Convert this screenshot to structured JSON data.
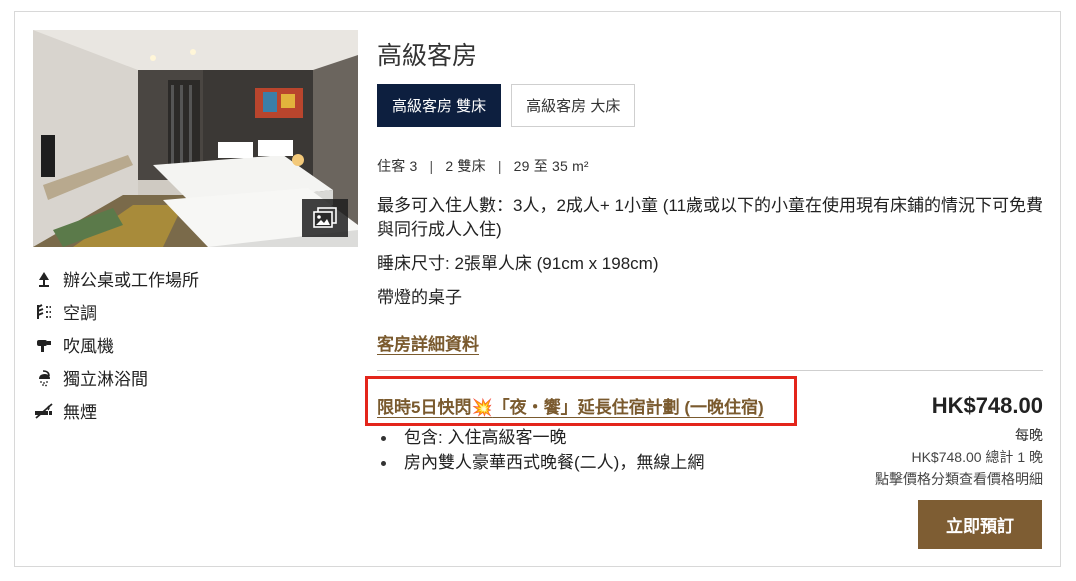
{
  "room": {
    "title": "高級客房",
    "tabs": [
      {
        "label": "高級客房 雙床",
        "active": true
      },
      {
        "label": "高級客房 大床",
        "active": false
      }
    ],
    "specs": {
      "guests": "住客 3",
      "beds": "2 雙床",
      "size": "29 至 35 m²",
      "separator": "|"
    },
    "description": [
      "最多可入住人數：3人，2成人+ 1小童 (11歲或以下的小童在使用現有床鋪的情況下可免費與同行成人入住)",
      "睡床尺寸: 2張單人床 (91cm x 198cm)",
      "帶燈的桌子"
    ],
    "details_link": "客房詳細資料"
  },
  "amenities": [
    {
      "icon": "desk-lamp-icon",
      "label": "辦公桌或工作場所"
    },
    {
      "icon": "air-conditioning-icon",
      "label": "空調"
    },
    {
      "icon": "hair-dryer-icon",
      "label": "吹風機"
    },
    {
      "icon": "shower-icon",
      "label": "獨立淋浴間"
    },
    {
      "icon": "no-smoking-icon",
      "label": "無煙"
    }
  ],
  "rate": {
    "name_prefix": "限時5日快閃",
    "name_emoji": "💥",
    "name_suffix": "「夜・饗」延長住宿計劃 (一晚住宿)",
    "inclusions": [
      "包含: 入住高級客一晚",
      "房內雙人豪華西式晚餐(二人)，無線上網"
    ],
    "price": "HK$748.00",
    "per_night": "每晚",
    "total": "HK$748.00 總計 1 晚",
    "breakdown_hint": "點擊價格分類查看價格明細",
    "book_label": "立即預訂"
  },
  "colors": {
    "active_tab": "#0d1f3f",
    "link_brown": "#7a5a2e",
    "book_button": "#7e5d33",
    "highlight_box": "#e3251b"
  }
}
